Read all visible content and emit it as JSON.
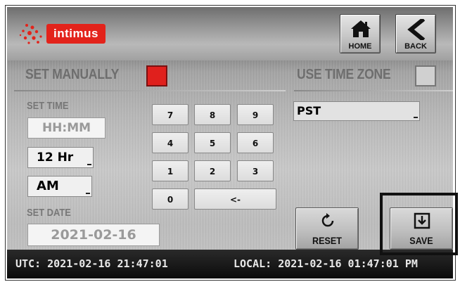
{
  "brand": {
    "logo_text": "intimus",
    "color": "#e3231b"
  },
  "header": {
    "home_label": "HOME",
    "home_icon": "home-icon",
    "back_label": "BACK",
    "back_icon": "chevron-left-icon"
  },
  "mode": {
    "set_manually_label": "SET MANUALLY",
    "set_manually_checked": true,
    "use_time_zone_label": "USE TIME ZONE",
    "use_time_zone_checked": false
  },
  "time": {
    "title": "SET TIME",
    "value": "HH:MM",
    "format_selected": "12 Hr",
    "ampm_selected": "AM"
  },
  "date": {
    "title": "SET DATE",
    "value": "2021-02-16"
  },
  "keypad": {
    "keys": [
      "7",
      "8",
      "9",
      "4",
      "5",
      "6",
      "1",
      "2",
      "3",
      "0",
      "<-"
    ]
  },
  "timezone": {
    "selected": "PST"
  },
  "actions": {
    "reset_label": "RESET",
    "reset_icon": "refresh-icon",
    "save_label": "SAVE",
    "save_icon": "save-download-icon"
  },
  "status": {
    "utc": "UTC: 2021-02-16 21:47:01",
    "local": "LOCAL: 2021-02-16 01:47:01 PM"
  }
}
